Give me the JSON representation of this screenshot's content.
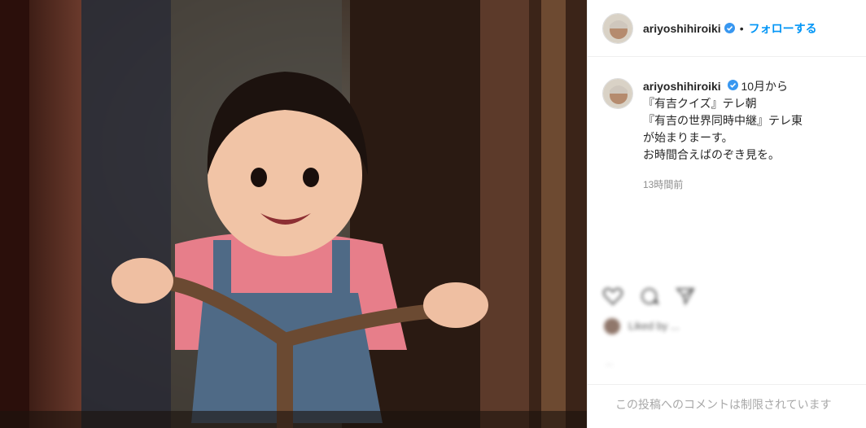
{
  "post": {
    "image_alt": "toddler photo",
    "username": "ariyoshihiroiki",
    "follow_separator": "•",
    "follow_label": "フォローする",
    "caption_username": "ariyoshihiroiki",
    "caption_lines": [
      "10月から",
      "『有吉クイズ』テレ朝",
      "『有吉の世界同時中継』テレ東",
      "が始まりまーす。",
      "お時間合えばのぞき見を。"
    ],
    "timestamp": "13時間前",
    "liked_by_text": "Liked by ...",
    "date_text": "...",
    "comments_disabled": "この投稿へのコメントは制限されています"
  },
  "icons": {
    "verified": "verified-badge-icon",
    "like": "heart-icon",
    "comment": "comment-icon",
    "share": "share-icon"
  },
  "colors": {
    "link": "#0095f6",
    "verified": "#3897f0",
    "text": "#262626",
    "muted": "#8e8e8e"
  }
}
